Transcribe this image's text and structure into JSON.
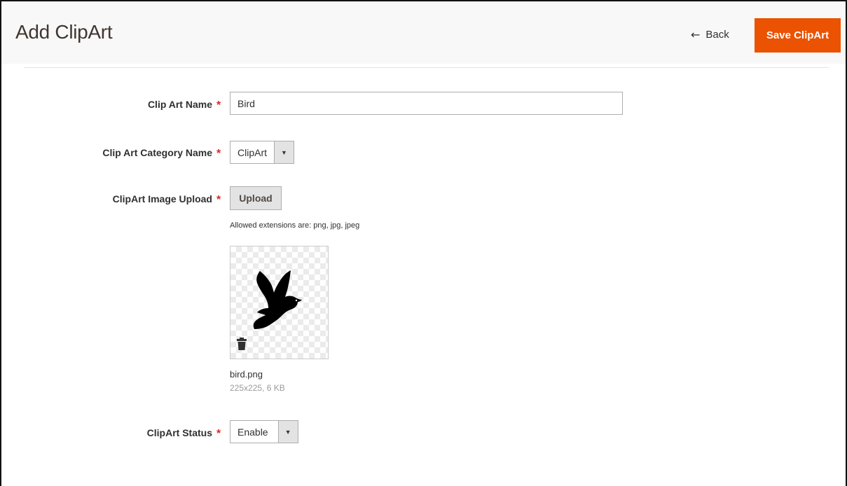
{
  "header": {
    "title": "Add ClipArt",
    "back_label": "Back",
    "back_icon": "left-arrow-icon",
    "save_label": "Save ClipArt"
  },
  "form": {
    "name": {
      "label": "Clip Art Name",
      "required_mark": "*",
      "value": "Bird"
    },
    "category": {
      "label": "Clip Art Category Name",
      "required_mark": "*",
      "selected": "ClipArt"
    },
    "image": {
      "label": "ClipArt Image Upload",
      "required_mark": "*",
      "button_label": "Upload",
      "hint": "Allowed extensions are: png, jpg, jpeg",
      "file_name": "bird.png",
      "file_meta": "225x225, 6 KB"
    },
    "status": {
      "label": "ClipArt Status",
      "required_mark": "*",
      "selected": "Enable"
    }
  },
  "colors": {
    "accent": "#eb5202",
    "required": "#e22626",
    "header_bg": "#f8f8f8"
  }
}
